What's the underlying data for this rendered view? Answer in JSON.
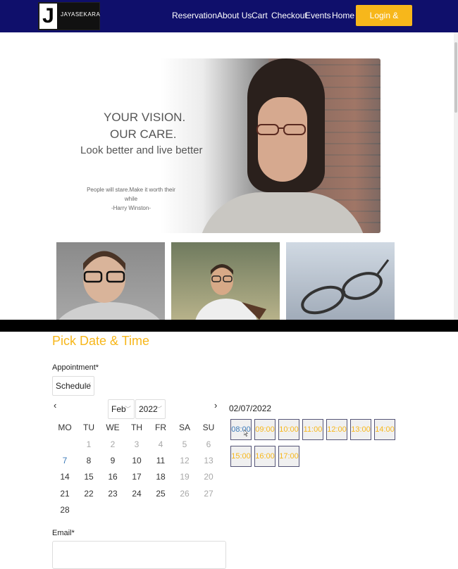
{
  "nav": {
    "logo_letter": "J",
    "logo_name": "JAYASEKARA",
    "links": [
      "Reservation",
      "About Us",
      "Cart",
      "Checkout",
      "Events",
      "Home"
    ],
    "cta": "Login & Signup",
    "colors": {
      "bar": "#0f0f6b",
      "accent": "#f7b71b"
    }
  },
  "hero": {
    "line1": "YOUR VISION.",
    "line2": "OUR CARE.",
    "line3": "Look better and live better",
    "quote": "People will stare.Make it worth their while",
    "author": "-Harry Winston-"
  },
  "booking": {
    "title": "Pick Date & Time",
    "appointment_label": "Appointment*",
    "appointment_value": "Schedule",
    "month": "Feb",
    "year": "2022",
    "prev_icon": "‹",
    "next_icon": "›",
    "weekdays": [
      "MO",
      "TU",
      "WE",
      "TH",
      "FR",
      "SA",
      "SU"
    ],
    "weeks": [
      [
        "",
        "1",
        "2",
        "3",
        "4",
        "5",
        "6"
      ],
      [
        "7",
        "8",
        "9",
        "10",
        "11",
        "12",
        "13"
      ],
      [
        "14",
        "15",
        "16",
        "17",
        "18",
        "19",
        "20"
      ],
      [
        "21",
        "22",
        "23",
        "24",
        "25",
        "26",
        "27"
      ],
      [
        "28"
      ]
    ],
    "selected_date": "02/07/2022",
    "time_slots": [
      "08:00",
      "09:00",
      "10:00",
      "11:00",
      "12:00",
      "13:00",
      "14:00",
      "15:00",
      "16:00",
      "17:00"
    ],
    "selected_slot": "08:00",
    "email_label": "Email*"
  }
}
